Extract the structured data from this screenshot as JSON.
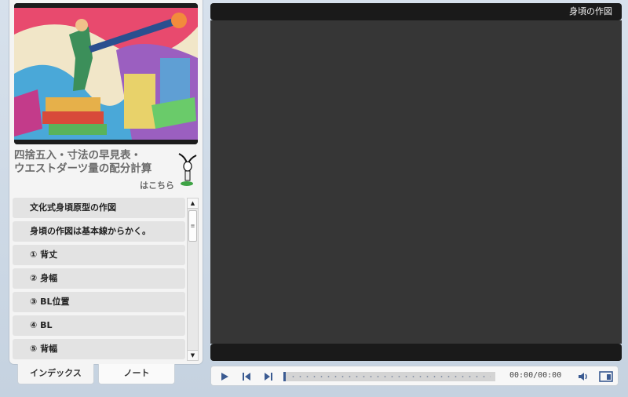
{
  "header": {
    "title": "身頃の作図"
  },
  "lesson": {
    "title_line1": "四捨五入・寸法の早見表・",
    "title_line2": "ウエストダーツ量の配分計算",
    "title_sub": "はこちら"
  },
  "index": {
    "items": [
      {
        "label": "文化式身頃原型の作図"
      },
      {
        "label": "身頃の作図は基本線からかく。"
      },
      {
        "label": "① 背丈"
      },
      {
        "label": "② 身幅"
      },
      {
        "label": "③ BL位置"
      },
      {
        "label": "④ BL"
      },
      {
        "label": "⑤ 背幅"
      }
    ]
  },
  "tabs": [
    {
      "label": "インデックス"
    },
    {
      "label": "ノート"
    }
  ],
  "player": {
    "time": "00:00/00:00",
    "progress": 0
  },
  "colors": {
    "accent": "#3b5b92",
    "video_bg": "#363636",
    "bar_bg": "#1a1a1a"
  }
}
